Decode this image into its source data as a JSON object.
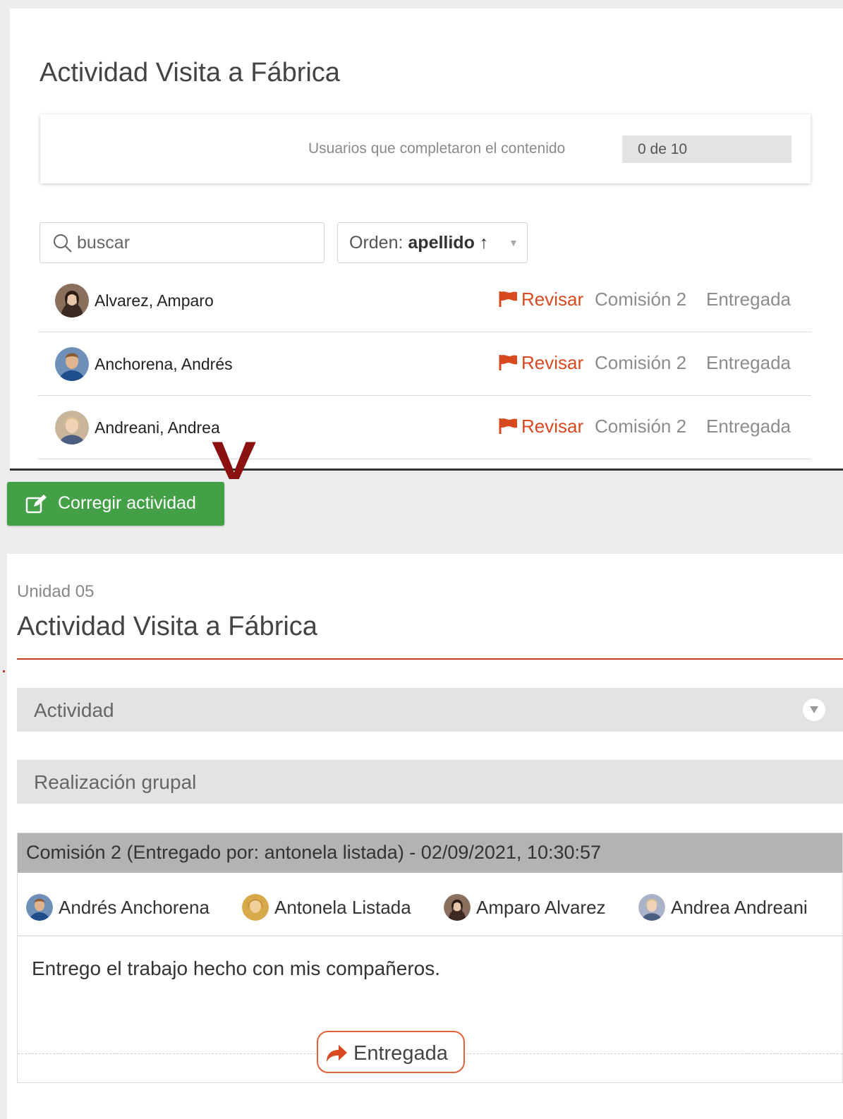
{
  "top": {
    "title": "Actividad Visita a Fábrica",
    "progress_label": "Usuarios que completaron el contenido",
    "progress_value": "0 de 10",
    "search_placeholder": "buscar",
    "order_label": "Orden:",
    "order_value": "apellido ↑",
    "students": [
      {
        "name": "Alvarez, Amparo",
        "review": "Revisar",
        "comision": "Comisión 2",
        "status": "Entregada",
        "avatar_color": "#3b2a22"
      },
      {
        "name": "Anchorena, Andrés",
        "review": "Revisar",
        "comision": "Comisión 2",
        "status": "Entregada",
        "avatar_color": "#1f4e8c"
      },
      {
        "name": "Andreani, Andrea",
        "review": "Revisar",
        "comision": "Comisión 2",
        "status": "Entregada",
        "avatar_color": "#c9b69a"
      }
    ]
  },
  "annotation": {
    "mark": "V"
  },
  "button": {
    "label": "Corregir actividad"
  },
  "detail": {
    "unit": "Unidad 05",
    "title": "Actividad Visita a Fábrica",
    "sections": [
      "Actividad",
      "Realización grupal"
    ],
    "group": {
      "header": "Comisión 2 (Entregado por: antonela listada) - 02/09/2021, 10:30:57",
      "members": [
        {
          "name": "Andrés Anchorena",
          "avatar_color": "#1f4e8c"
        },
        {
          "name": "Antonela Listada",
          "avatar_color": "#d7a94a"
        },
        {
          "name": "Amparo Alvarez",
          "avatar_color": "#3b2a22"
        },
        {
          "name": "Andrea Andreani",
          "avatar_color": "#a9b2c8"
        }
      ],
      "message": "Entrego el trabajo hecho con mis compañeros.",
      "status": "Entregada"
    }
  },
  "colors": {
    "accent_red": "#d8491f",
    "button_green": "#43a047",
    "divider_red": "#c0392b",
    "annotation_red": "#8b1010"
  }
}
